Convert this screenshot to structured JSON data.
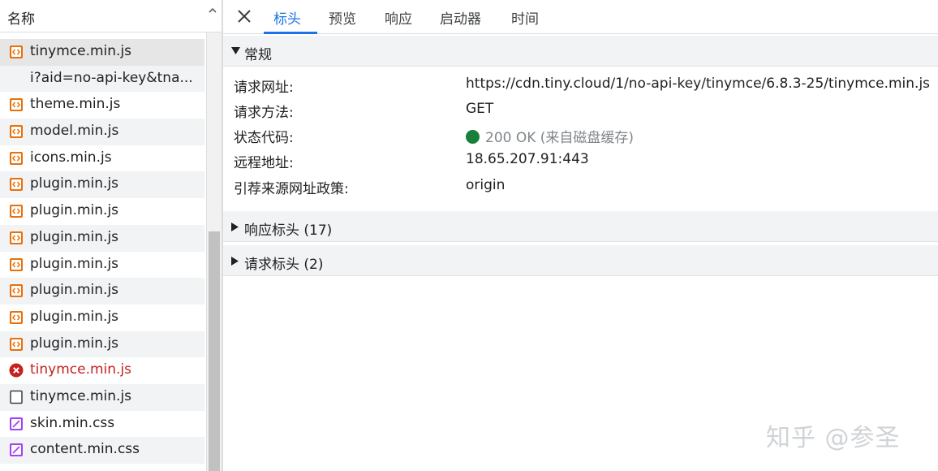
{
  "list": {
    "header": "名称",
    "rows": [
      {
        "name": "tinymce.min.js",
        "type": "script",
        "selected": true
      },
      {
        "name": "i?aid=no-api-key&tna...",
        "type": "none"
      },
      {
        "name": "theme.min.js",
        "type": "script"
      },
      {
        "name": "model.min.js",
        "type": "script"
      },
      {
        "name": "icons.min.js",
        "type": "script"
      },
      {
        "name": "plugin.min.js",
        "type": "script"
      },
      {
        "name": "plugin.min.js",
        "type": "script"
      },
      {
        "name": "plugin.min.js",
        "type": "script"
      },
      {
        "name": "plugin.min.js",
        "type": "script"
      },
      {
        "name": "plugin.min.js",
        "type": "script"
      },
      {
        "name": "plugin.min.js",
        "type": "script"
      },
      {
        "name": "plugin.min.js",
        "type": "script"
      },
      {
        "name": "tinymce.min.js",
        "type": "error"
      },
      {
        "name": "tinymce.min.js",
        "type": "document"
      },
      {
        "name": "skin.min.css",
        "type": "stylesheet"
      },
      {
        "name": "content.min.css",
        "type": "stylesheet"
      }
    ]
  },
  "tabs": [
    "标头",
    "预览",
    "响应",
    "启动器",
    "时间"
  ],
  "active_tab": "标头",
  "general": {
    "title": "常规",
    "rows": [
      {
        "label": "请求网址:",
        "value": "https://cdn.tiny.cloud/1/no-api-key/tinymce/6.8.3-25/tinymce.min.js"
      },
      {
        "label": "请求方法:",
        "value": "GET"
      },
      {
        "label": "状态代码:",
        "value": "200 OK",
        "note": "(来自磁盘缓存)"
      },
      {
        "label": "远程地址:",
        "value": "18.65.207.91:443"
      },
      {
        "label": "引荐来源网址政策:",
        "value": "origin"
      }
    ]
  },
  "response_headers": {
    "title": "响应标头 (17)"
  },
  "request_headers": {
    "title": "请求标头 (2)"
  },
  "colors": {
    "accent": "#1a73e8",
    "status_ok": "#188038",
    "error": "#c5221f",
    "script_icon": "#e8710a",
    "stylesheet_icon": "#a142f4"
  },
  "watermark": "知乎 @参圣"
}
